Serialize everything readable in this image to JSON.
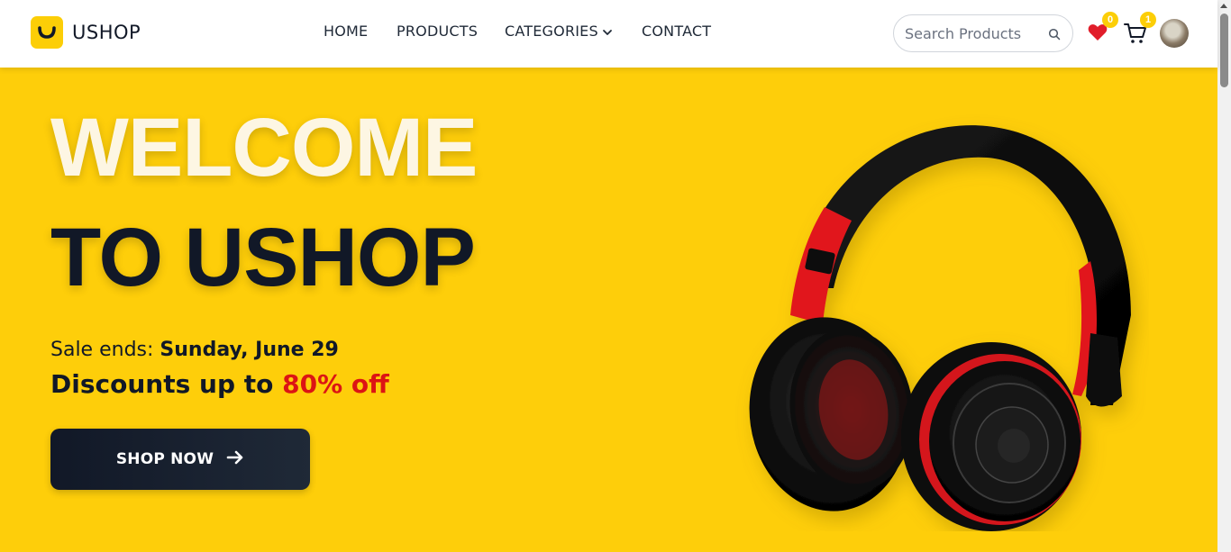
{
  "brand": {
    "name": "USHOP"
  },
  "nav": {
    "home": "HOME",
    "products": "PRODUCTS",
    "categories": "CATEGORIES",
    "contact": "CONTACT"
  },
  "search": {
    "placeholder": "Search Products",
    "value": ""
  },
  "wishlist": {
    "count": "0"
  },
  "cart": {
    "count": "1"
  },
  "hero": {
    "title_line1": "WELCOME",
    "title_line2": "TO USHOP",
    "sale_prefix": "Sale ends: ",
    "sale_date": "Sunday, June 29",
    "discount_prefix": "Discounts up to ",
    "discount_value": "80% off",
    "cta_label": "SHOP NOW"
  },
  "colors": {
    "accent_yellow": "#fece0a",
    "dark": "#111827",
    "discount_red": "#dc1414",
    "heart_red": "#e11d2a"
  },
  "icons": {
    "logo": "smile-logo-icon",
    "search": "search-icon",
    "wishlist": "heart-icon",
    "cart": "cart-icon",
    "cta": "arrow-right-icon",
    "dropdown": "chevron-down-icon"
  }
}
